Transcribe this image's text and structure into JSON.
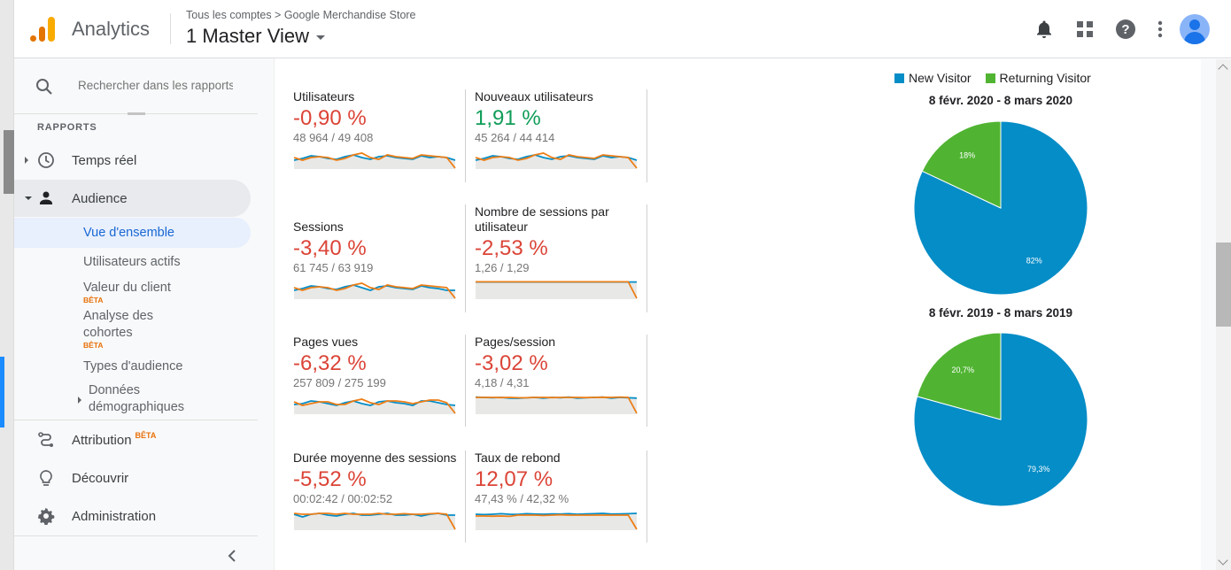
{
  "header": {
    "app_name": "Analytics",
    "breadcrumb": "Tous les comptes > Google Merchandise Store",
    "view_name": "1 Master View",
    "icons": [
      "bell-icon",
      "apps-grid-icon",
      "help-icon",
      "more-vert-icon",
      "account-avatar"
    ]
  },
  "sidebar": {
    "search_placeholder": "Rechercher dans les rapports",
    "section_label": "RAPPORTS",
    "items": [
      {
        "label": "Temps réel",
        "icon": "clock-icon"
      },
      {
        "label": "Audience",
        "icon": "person-icon"
      },
      {
        "label": "Attribution",
        "icon": "attribution-icon",
        "badge": "BÊTA"
      },
      {
        "label": "Découvrir",
        "icon": "lightbulb-icon"
      },
      {
        "label": "Administration",
        "icon": "gear-icon"
      }
    ],
    "audience_sub": [
      {
        "label": "Vue d'ensemble",
        "active": true
      },
      {
        "label": "Utilisateurs actifs"
      },
      {
        "label": "Valeur du client",
        "badge": "BÊTA"
      },
      {
        "label": "Analyse des cohortes",
        "line1": "Analyse des",
        "line2": "cohortes",
        "badge": "BÊTA"
      },
      {
        "label": "Types d'audience"
      },
      {
        "label": "Données démographiques",
        "line1": "Données",
        "line2": "démographiques"
      }
    ]
  },
  "metrics": [
    {
      "title": "Utilisateurs",
      "pct": "-0,90 %",
      "trend": "neg",
      "values": "48 964 / 49 408"
    },
    {
      "title": "Nouveaux utilisateurs",
      "pct": "1,91 %",
      "trend": "pos",
      "values": "45 264 / 44 414"
    },
    {
      "title": "Sessions",
      "pct": "-3,40 %",
      "trend": "neg",
      "values": "61 745 / 63 919"
    },
    {
      "title": "Nombre de sessions par utilisateur",
      "title_line1": "Nombre de sessions par",
      "title_line2": "utilisateur",
      "pct": "-2,53 %",
      "trend": "neg",
      "values": "1,26 / 1,29"
    },
    {
      "title": "Pages vues",
      "pct": "-6,32 %",
      "trend": "neg",
      "values": "257 809 / 275 199"
    },
    {
      "title": "Pages/session",
      "pct": "-3,02 %",
      "trend": "neg",
      "values": "4,18 / 4,31"
    },
    {
      "title": "Durée moyenne des sessions",
      "pct": "-5,52 %",
      "trend": "neg",
      "values": "00:02:42 / 00:02:52"
    },
    {
      "title": "Taux de rebond",
      "pct": "12,07 %",
      "trend": "neg",
      "values": "47,43 % / 42,32 %"
    }
  ],
  "colors": {
    "new_visitor": "#058dc7",
    "returning_visitor": "#50b432",
    "spark_current": "#058dc7",
    "spark_previous": "#ed7e17",
    "negative": "#db4437",
    "positive": "#0f9d58"
  },
  "chart_data": [
    {
      "type": "pie",
      "title": "8 févr. 2020 - 8 mars 2020",
      "legend": [
        "New Visitor",
        "Returning Visitor"
      ],
      "legend_position": "top",
      "categories": [
        "New Visitor",
        "Returning Visitor"
      ],
      "values": [
        82,
        18
      ],
      "labels": [
        "82%",
        "18%"
      ]
    },
    {
      "type": "pie",
      "title": "8 févr. 2019 - 8 mars 2019",
      "legend": [
        "New Visitor",
        "Returning Visitor"
      ],
      "legend_position": "top",
      "categories": [
        "New Visitor",
        "Returning Visitor"
      ],
      "values": [
        79.3,
        20.7
      ],
      "labels": [
        "79,3%",
        "20,7%"
      ]
    }
  ],
  "sparklines": [
    {
      "current": [
        0.45,
        0.55,
        0.7,
        0.65,
        0.55,
        0.5,
        0.65,
        0.75,
        0.6,
        0.5,
        0.65,
        0.7,
        0.6,
        0.55,
        0.5,
        0.7,
        0.6,
        0.65,
        0.6,
        0.45
      ],
      "previous": [
        0.6,
        0.45,
        0.6,
        0.65,
        0.6,
        0.45,
        0.55,
        0.75,
        0.85,
        0.6,
        0.5,
        0.75,
        0.65,
        0.6,
        0.55,
        0.75,
        0.7,
        0.65,
        0.6,
        0.0
      ]
    },
    {
      "current": [
        0.45,
        0.55,
        0.7,
        0.65,
        0.55,
        0.5,
        0.65,
        0.75,
        0.6,
        0.5,
        0.65,
        0.7,
        0.6,
        0.55,
        0.5,
        0.7,
        0.6,
        0.65,
        0.6,
        0.45
      ],
      "previous": [
        0.6,
        0.45,
        0.6,
        0.65,
        0.6,
        0.45,
        0.55,
        0.75,
        0.85,
        0.6,
        0.5,
        0.75,
        0.65,
        0.6,
        0.55,
        0.75,
        0.7,
        0.65,
        0.6,
        0.0
      ]
    },
    {
      "current": [
        0.45,
        0.55,
        0.7,
        0.65,
        0.55,
        0.5,
        0.65,
        0.75,
        0.6,
        0.45,
        0.65,
        0.7,
        0.6,
        0.55,
        0.5,
        0.7,
        0.6,
        0.55,
        0.45,
        0.45
      ],
      "previous": [
        0.6,
        0.45,
        0.6,
        0.65,
        0.6,
        0.45,
        0.55,
        0.75,
        0.85,
        0.6,
        0.5,
        0.75,
        0.65,
        0.6,
        0.55,
        0.75,
        0.7,
        0.65,
        0.6,
        0.0
      ]
    },
    {
      "current": [
        0.92,
        0.92,
        0.92,
        0.92,
        0.92,
        0.92,
        0.92,
        0.92,
        0.92,
        0.92,
        0.92,
        0.92,
        0.92,
        0.92,
        0.92,
        0.92,
        0.92,
        0.92,
        0.92,
        0.92
      ],
      "previous": [
        0.93,
        0.93,
        0.93,
        0.93,
        0.93,
        0.93,
        0.93,
        0.93,
        0.93,
        0.93,
        0.93,
        0.93,
        0.93,
        0.93,
        0.93,
        0.93,
        0.93,
        0.93,
        0.93,
        0.0
      ]
    },
    {
      "current": [
        0.5,
        0.55,
        0.7,
        0.65,
        0.55,
        0.45,
        0.6,
        0.7,
        0.55,
        0.45,
        0.65,
        0.7,
        0.6,
        0.55,
        0.45,
        0.7,
        0.7,
        0.6,
        0.5,
        0.45
      ],
      "previous": [
        0.65,
        0.45,
        0.55,
        0.65,
        0.65,
        0.5,
        0.5,
        0.7,
        0.8,
        0.6,
        0.5,
        0.7,
        0.7,
        0.65,
        0.55,
        0.65,
        0.75,
        0.75,
        0.6,
        0.0
      ]
    },
    {
      "current": [
        0.92,
        0.9,
        0.88,
        0.9,
        0.86,
        0.85,
        0.88,
        0.9,
        0.86,
        0.9,
        0.88,
        0.92,
        0.86,
        0.88,
        0.9,
        0.92,
        0.86,
        0.9,
        0.88,
        0.86
      ],
      "previous": [
        0.9,
        0.9,
        0.9,
        0.89,
        0.9,
        0.88,
        0.88,
        0.9,
        0.9,
        0.89,
        0.9,
        0.9,
        0.9,
        0.89,
        0.9,
        0.91,
        0.9,
        0.92,
        0.9,
        0.0
      ]
    },
    {
      "current": [
        0.85,
        0.7,
        0.85,
        0.9,
        0.8,
        0.75,
        0.85,
        0.9,
        0.8,
        0.8,
        0.85,
        0.9,
        0.8,
        0.8,
        0.85,
        0.75,
        0.85,
        0.9,
        0.8,
        0.8
      ],
      "previous": [
        0.9,
        0.85,
        0.85,
        0.9,
        0.9,
        0.85,
        0.9,
        0.85,
        0.85,
        0.85,
        0.9,
        0.85,
        0.85,
        0.88,
        0.85,
        0.85,
        0.88,
        0.9,
        0.85,
        0.0
      ]
    },
    {
      "current": [
        0.85,
        0.83,
        0.85,
        0.88,
        0.85,
        0.84,
        0.88,
        0.86,
        0.85,
        0.87,
        0.86,
        0.88,
        0.85,
        0.87,
        0.88,
        0.9,
        0.86,
        0.87,
        0.88,
        0.9
      ],
      "previous": [
        0.75,
        0.75,
        0.74,
        0.75,
        0.73,
        0.8,
        0.8,
        0.8,
        0.78,
        0.8,
        0.82,
        0.8,
        0.8,
        0.8,
        0.8,
        0.8,
        0.8,
        0.8,
        0.8,
        0.0
      ]
    }
  ]
}
